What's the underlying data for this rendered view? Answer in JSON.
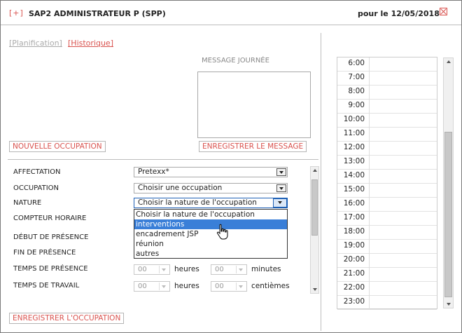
{
  "header": {
    "plus_label": "[+]",
    "title": "SAP2 ADMINISTRATEUR P (SPP)",
    "date_label": "pour le 12/05/2018"
  },
  "links": {
    "planification": "[Planification]",
    "historique": "[Historique]"
  },
  "message": {
    "label": "MESSAGE JOURNÉE",
    "value": "",
    "save_button": "ENREGISTRER LE MESSAGE"
  },
  "buttons": {
    "nouvelle_occupation": "NOUVELLE OCCUPATION",
    "enregistrer_occupation": "ENREGISTRER L'OCCUPATION"
  },
  "form": {
    "affectation": {
      "label": "AFFECTATION",
      "value": "Pretexx*"
    },
    "occupation": {
      "label": "OCCUPATION",
      "value": "Choisir une occupation"
    },
    "nature": {
      "label": "NATURE",
      "value": "Choisir la nature de l'occupation",
      "options": [
        "Choisir la nature de l'occupation",
        "interventions",
        "encadrement JSP",
        "réunion",
        "autres"
      ],
      "highlighted_index": 1
    },
    "compteur_horaire": {
      "label": "COMPTEUR HORAIRE"
    },
    "debut_presence": {
      "label": "DÉBUT DE PRÉSENCE"
    },
    "fin_presence": {
      "label": "FIN DE PRÉSENCE"
    },
    "temps_presence": {
      "label": "TEMPS DE PRÉSENCE",
      "hours_value": "00",
      "hours_unit": "heures",
      "minutes_value": "00",
      "minutes_unit": "minutes"
    },
    "temps_travail": {
      "label": "TEMPS DE TRAVAIL",
      "hours_value": "00",
      "hours_unit": "heures",
      "cent_value": "00",
      "cent_unit": "centièmes"
    }
  },
  "timeline": {
    "hours": [
      "6:00",
      "7:00",
      "8:00",
      "9:00",
      "10:00",
      "11:00",
      "12:00",
      "13:00",
      "14:00",
      "15:00",
      "16:00",
      "17:00",
      "18:00",
      "19:00",
      "20:00",
      "21:00",
      "22:00",
      "23:00"
    ]
  },
  "icons": {
    "add": "plus-icon",
    "close": "close-icon",
    "cursor": "hand-pointer-icon"
  },
  "colors": {
    "accent_red": "#d9534f",
    "selection_blue": "#3a7fd8"
  }
}
